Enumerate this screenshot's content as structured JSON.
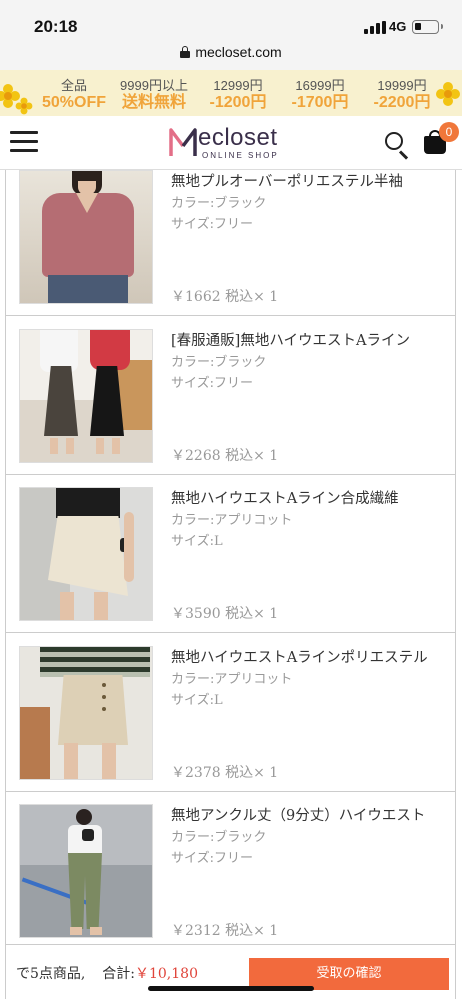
{
  "status_bar": {
    "time": "20:18",
    "network": "4G"
  },
  "browser": {
    "url": "mecloset.com"
  },
  "promo": {
    "columns": [
      {
        "top": "全品",
        "bottom": "50%OFF"
      },
      {
        "top": "9999円以上",
        "bottom": "送料無料"
      },
      {
        "top": "12999円",
        "bottom": "-1200円"
      },
      {
        "top": "16999円",
        "bottom": "-1700円"
      },
      {
        "top": "19999円",
        "bottom": "-2200円"
      }
    ]
  },
  "header": {
    "logo_text": "ecloset",
    "logo_sub": "ONLINE SHOP",
    "cart_count": "0"
  },
  "items": [
    {
      "name": "無地プルオーバーポリエステル半袖",
      "color": "カラー:ブラック",
      "size": "サイズ:フリー",
      "price": "￥1662 税込× 1"
    },
    {
      "name": "[春服通販]無地ハイウエストAライン",
      "color": "カラー:ブラック",
      "size": "サイズ:フリー",
      "price": "￥2268 税込× 1"
    },
    {
      "name": "無地ハイウエストAライン合成繊維",
      "color": "カラー:アプリコット",
      "size": "サイズ:L",
      "price": "￥3590 税込× 1"
    },
    {
      "name": "無地ハイウエストAラインポリエステル",
      "color": "カラー:アプリコット",
      "size": "サイズ:L",
      "price": "￥2378 税込× 1"
    },
    {
      "name": "無地アンクル丈（9分丈）ハイウエスト",
      "color": "カラー:ブラック",
      "size": "サイズ:フリー",
      "price": "￥2312 税込× 1"
    }
  ],
  "footer": {
    "count_text": "で5点商品,",
    "total_label": "合計:",
    "total_amount": "￥10,180",
    "confirm_label": "受取の確認"
  },
  "colors": {
    "accent": "#f26a3d",
    "price_red": "#e0443a",
    "promo_bg": "#f8f1cf",
    "promo_text": "#f0a43a"
  }
}
